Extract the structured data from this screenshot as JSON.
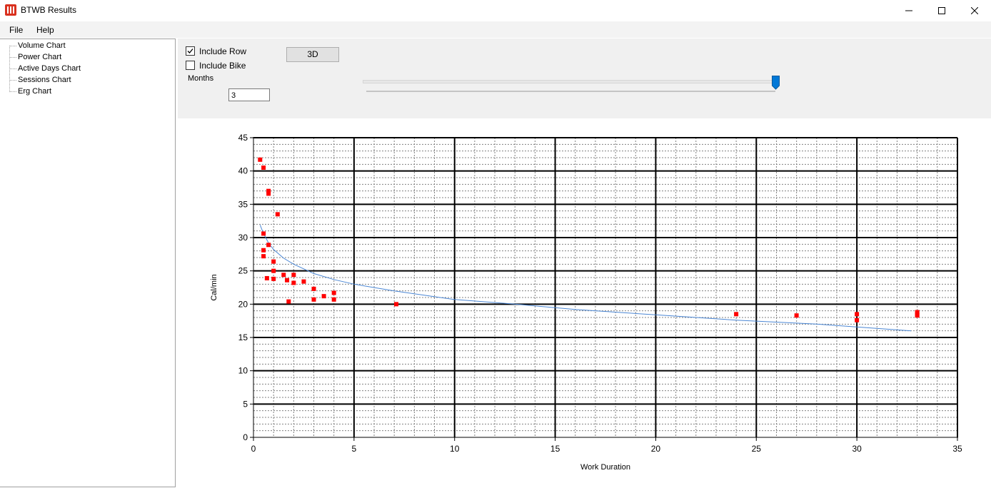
{
  "window": {
    "title": "BTWB Results",
    "controls": [
      "minimize-icon",
      "maximize-icon",
      "close-icon"
    ]
  },
  "menu": {
    "items": [
      "File",
      "Help"
    ]
  },
  "tree": {
    "items": [
      "Volume Chart",
      "Power Chart",
      "Active Days Chart",
      "Sessions Chart",
      "Erg Chart"
    ]
  },
  "controls": {
    "include_row": {
      "label": "Include Row",
      "checked": true
    },
    "include_bike": {
      "label": "Include Bike",
      "checked": false
    },
    "button_3d": "3D",
    "months_label": "Months",
    "months_value": "3",
    "slider_level": 1.0
  },
  "colors": {
    "points": "#ff0000",
    "trend": "#4a86d4",
    "thumb": "#0078d7"
  },
  "chart_data": {
    "type": "scatter",
    "xlabel": "Work Duration",
    "ylabel": "Cal/min",
    "xlim": [
      0,
      35
    ],
    "ylim": [
      0,
      45
    ],
    "x_ticks": [
      0,
      5,
      10,
      15,
      20,
      25,
      30,
      35
    ],
    "y_ticks": [
      0,
      5,
      10,
      15,
      20,
      25,
      30,
      35,
      40,
      45
    ],
    "grid": true,
    "points": [
      {
        "x": 0.33,
        "y": 41.7
      },
      {
        "x": 0.5,
        "y": 40.5
      },
      {
        "x": 0.75,
        "y": 37.0
      },
      {
        "x": 0.75,
        "y": 36.6
      },
      {
        "x": 1.2,
        "y": 33.5
      },
      {
        "x": 0.5,
        "y": 30.6
      },
      {
        "x": 0.75,
        "y": 28.9
      },
      {
        "x": 0.5,
        "y": 28.1
      },
      {
        "x": 0.5,
        "y": 27.2
      },
      {
        "x": 1.0,
        "y": 26.4
      },
      {
        "x": 1.0,
        "y": 25.0
      },
      {
        "x": 1.5,
        "y": 24.4
      },
      {
        "x": 2.0,
        "y": 24.4
      },
      {
        "x": 0.67,
        "y": 23.9
      },
      {
        "x": 1.0,
        "y": 23.8
      },
      {
        "x": 1.67,
        "y": 23.6
      },
      {
        "x": 2.5,
        "y": 23.4
      },
      {
        "x": 2.0,
        "y": 23.2
      },
      {
        "x": 3.0,
        "y": 22.3
      },
      {
        "x": 4.0,
        "y": 21.7
      },
      {
        "x": 3.5,
        "y": 21.2
      },
      {
        "x": 3.0,
        "y": 20.7
      },
      {
        "x": 4.0,
        "y": 20.7
      },
      {
        "x": 1.75,
        "y": 20.4
      },
      {
        "x": 7.1,
        "y": 20.0
      },
      {
        "x": 24.0,
        "y": 18.5
      },
      {
        "x": 27.0,
        "y": 18.3
      },
      {
        "x": 30.0,
        "y": 18.5
      },
      {
        "x": 30.0,
        "y": 17.6
      },
      {
        "x": 33.0,
        "y": 18.8
      },
      {
        "x": 33.0,
        "y": 18.5
      },
      {
        "x": 33.0,
        "y": 18.3
      }
    ],
    "trendline": {
      "x": [
        0.33,
        0.5,
        0.75,
        1,
        1.5,
        2,
        3,
        4,
        5,
        7,
        10,
        13,
        16,
        20,
        24,
        28,
        32.7
      ],
      "y": [
        31.9,
        30.6,
        29.2,
        28.2,
        26.9,
        26.0,
        24.6,
        23.7,
        23.0,
        22.0,
        20.7,
        20.0,
        19.2,
        18.4,
        17.6,
        17.0,
        16.0
      ]
    }
  }
}
